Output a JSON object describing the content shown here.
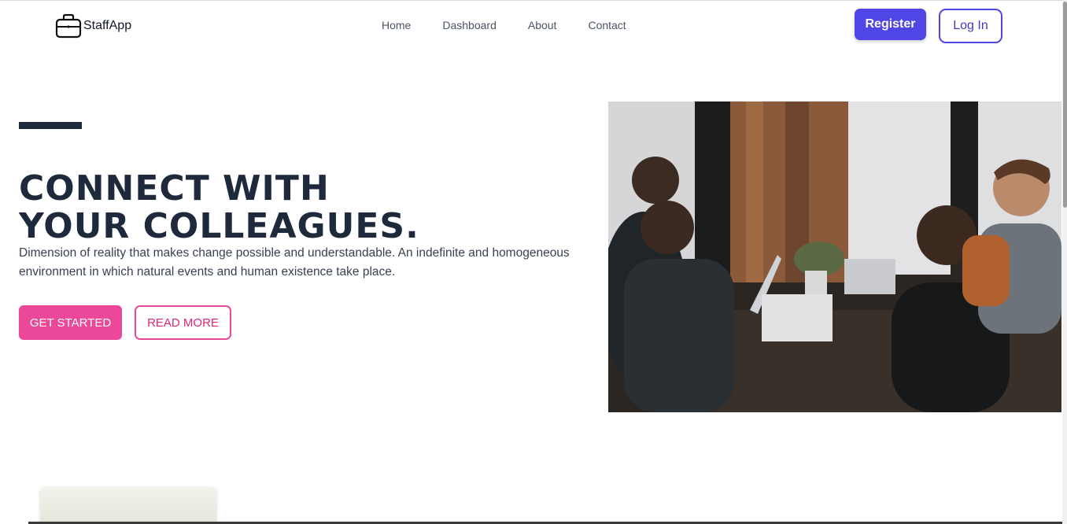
{
  "nav": {
    "brand": "StaffApp",
    "brand_icon": "briefcase-icon",
    "links": [
      "Home",
      "Dashboard",
      "About",
      "Contact"
    ],
    "register_label": "Register",
    "login_label": "Log In"
  },
  "hero": {
    "title_line1": "CONNECT WITH",
    "title_line2": "YOUR COLLEAGUES.",
    "description": "Dimension of reality that makes change possible and understandable. An indefinite and homogeneous environment in which natural events and human existence take place.",
    "primary_cta": "GET STARTED",
    "secondary_cta": "READ MORE"
  },
  "colors": {
    "primary": "#4f46e5",
    "accent": "#ec4899",
    "heading": "#1e293b"
  }
}
